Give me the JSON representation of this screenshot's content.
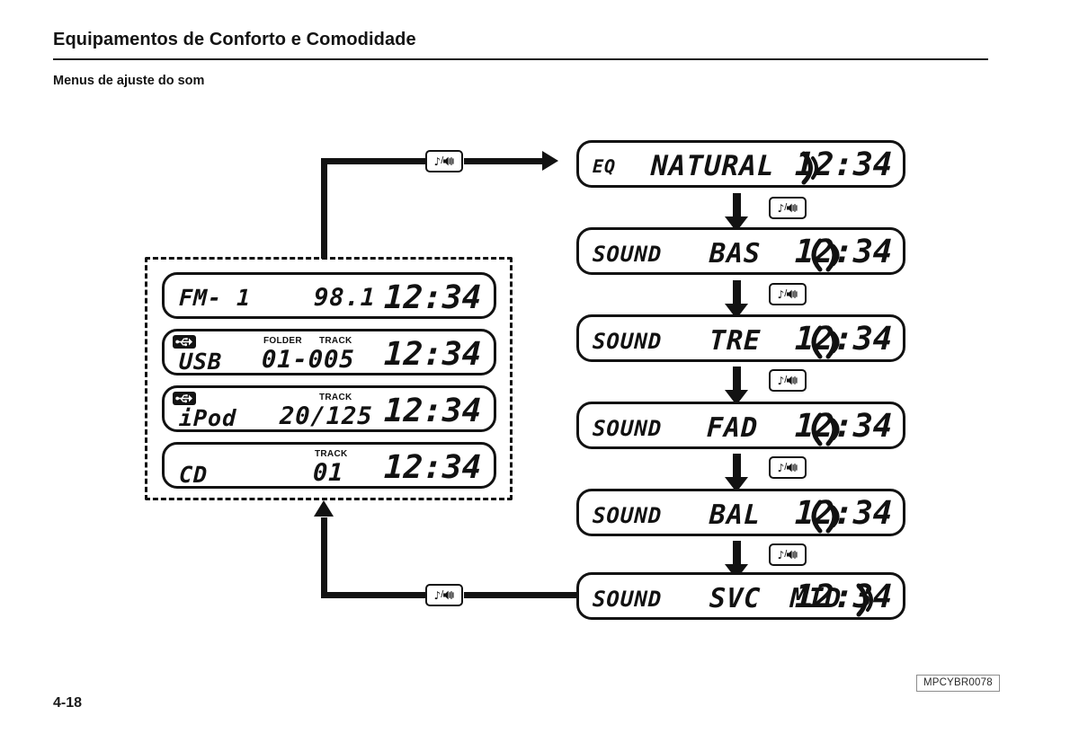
{
  "header": {
    "chapter_title": "Equipamentos de Conforto e Comodidade",
    "section_title": "Menus de ajuste do som"
  },
  "footer": {
    "page_number": "4-18",
    "figure_code": "MPCYBR0078"
  },
  "button": {
    "name": "audio-menu-button",
    "note_glyph": "♪",
    "separator": "/",
    "speaker_glyph": "speaker-icon"
  },
  "source_group": {
    "name": "source-displays-group",
    "displays": [
      {
        "id": "fm-display",
        "source": "FM- 1",
        "badge": null,
        "top_label": "",
        "top_label2": "",
        "value": "98.1",
        "clock": "12:34"
      },
      {
        "id": "usb-display",
        "source": "USB",
        "badge": "usb-icon",
        "top_label": "FOLDER",
        "top_label2": "TRACK",
        "value": "01-005",
        "clock": "12:34"
      },
      {
        "id": "ipod-display",
        "source": "iPod",
        "badge": "usb-icon",
        "top_label": "",
        "top_label2": "TRACK",
        "value": "20/125",
        "clock": "12:34"
      },
      {
        "id": "cd-display",
        "source": "CD",
        "badge": null,
        "top_label": "",
        "top_label2": "TRACK",
        "value": "01",
        "clock": "12:34"
      }
    ]
  },
  "menu_flow": {
    "name": "sound-menu-flow",
    "steps": [
      {
        "id": "eq-natural",
        "label": "EQ",
        "value": "NATURAL",
        "icon": "sound-wave-icon",
        "clock": "12:34"
      },
      {
        "id": "sound-bas",
        "label": "SOUND",
        "value": "BAS",
        "icon": "c-sound-wave-icon",
        "clock": "12:34"
      },
      {
        "id": "sound-tre",
        "label": "SOUND",
        "value": "TRE",
        "icon": "c-sound-wave-icon",
        "clock": "12:34"
      },
      {
        "id": "sound-fad",
        "label": "SOUND",
        "value": "FAD",
        "icon": "c-sound-wave-icon",
        "clock": "12:34"
      },
      {
        "id": "sound-bal",
        "label": "SOUND",
        "value": "BAL",
        "icon": "c-sound-wave-icon",
        "clock": "12:34"
      },
      {
        "id": "sound-svc",
        "label": "SOUND",
        "value": "SVC",
        "value2": "MID",
        "icon": "sound-wave-icon",
        "clock": "12:34"
      }
    ]
  },
  "colors": {
    "ink": "#121212",
    "paper": "#ffffff"
  }
}
